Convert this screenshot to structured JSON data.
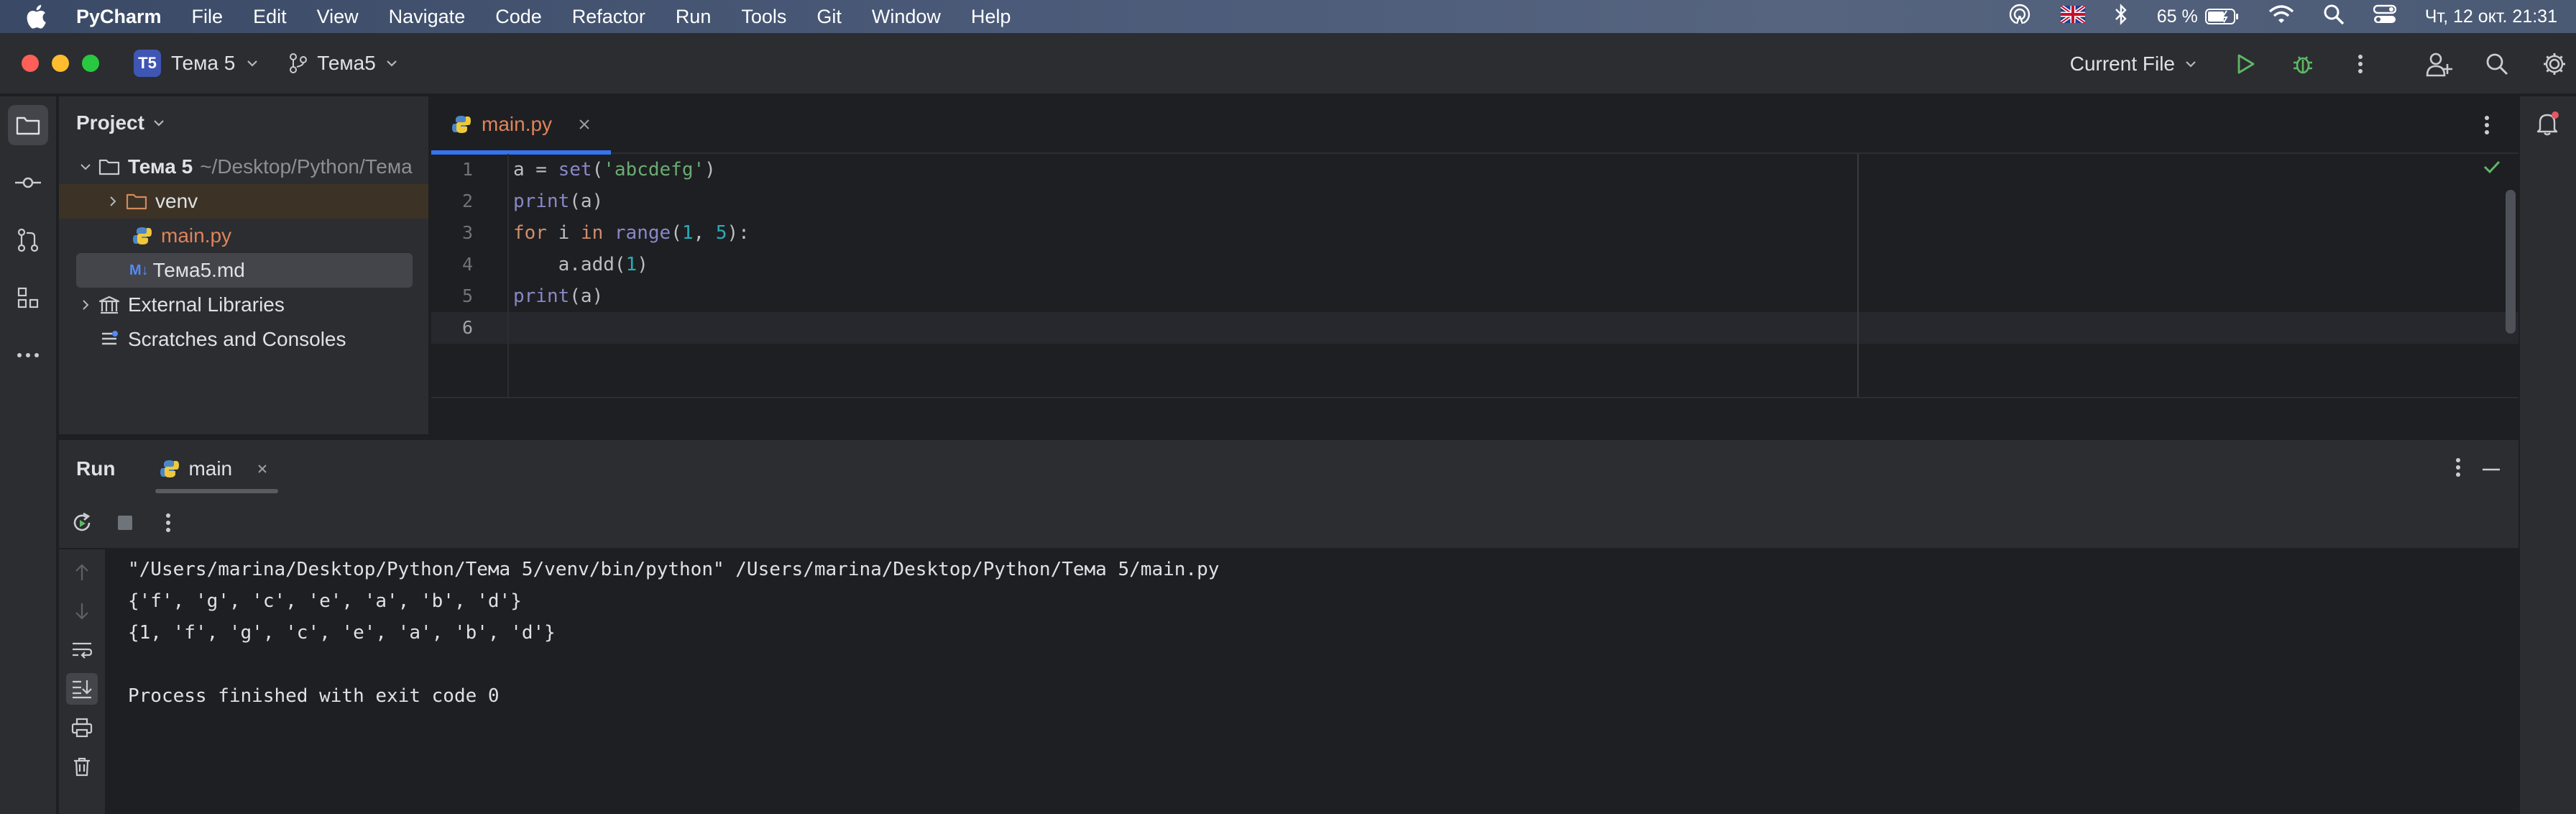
{
  "menubar": {
    "app_name": "PyCharm",
    "items": [
      "File",
      "Edit",
      "View",
      "Navigate",
      "Code",
      "Refactor",
      "Run",
      "Tools",
      "Git",
      "Window",
      "Help"
    ],
    "battery": "65 %",
    "datetime": "Чт, 12 окт.  21:31"
  },
  "toolbar": {
    "project_badge": "T5",
    "project_name": "Тема 5",
    "branch_name": "Тема5",
    "run_config": "Current File"
  },
  "project_panel": {
    "title": "Project",
    "root_name": "Тема 5",
    "root_path": "~/Desktop/Python/Тема",
    "items": [
      {
        "label": "venv"
      },
      {
        "label": "main.py"
      },
      {
        "label": "Тема5.md"
      },
      {
        "label": "External Libraries"
      },
      {
        "label": "Scratches and Consoles"
      }
    ],
    "md_badge": "M↓"
  },
  "editor": {
    "tab_label": "main.py",
    "line_numbers": [
      "1",
      "2",
      "3",
      "4",
      "5",
      "6"
    ],
    "lines": [
      [
        {
          "t": "a = ",
          "c": ""
        },
        {
          "t": "set",
          "c": "bi"
        },
        {
          "t": "(",
          "c": ""
        },
        {
          "t": "'abcdefg'",
          "c": "st"
        },
        {
          "t": ")",
          "c": ""
        }
      ],
      [
        {
          "t": "print",
          "c": "bi"
        },
        {
          "t": "(a)",
          "c": ""
        }
      ],
      [
        {
          "t": "for",
          "c": "kw"
        },
        {
          "t": " i ",
          "c": ""
        },
        {
          "t": "in",
          "c": "kw"
        },
        {
          "t": " ",
          "c": ""
        },
        {
          "t": "range",
          "c": "bi"
        },
        {
          "t": "(",
          "c": ""
        },
        {
          "t": "1",
          "c": "nu"
        },
        {
          "t": ", ",
          "c": ""
        },
        {
          "t": "5",
          "c": "nu"
        },
        {
          "t": "):",
          "c": ""
        }
      ],
      [
        {
          "t": "    a.add(",
          "c": ""
        },
        {
          "t": "1",
          "c": "nu"
        },
        {
          "t": ")",
          "c": ""
        }
      ],
      [
        {
          "t": "print",
          "c": "bi"
        },
        {
          "t": "(a)",
          "c": ""
        }
      ],
      [
        {
          "t": "",
          "c": ""
        }
      ]
    ]
  },
  "run_panel": {
    "title": "Run",
    "tab_label": "main",
    "console": [
      "\"/Users/marina/Desktop/Python/Тема 5/venv/bin/python\" /Users/marina/Desktop/Python/Тема 5/main.py",
      "{'f', 'g', 'c', 'e', 'a', 'b', 'd'}",
      "{1, 'f', 'g', 'c', 'e', 'a', 'b', 'd'}",
      "",
      "Process finished with exit code 0"
    ]
  },
  "colors": {
    "accent": "#3574f0",
    "open_file": "#e0835a",
    "keyword": "#cf8e6d",
    "builtin": "#8888c6",
    "string": "#6aab73",
    "number": "#2aacb8",
    "run_green": "#5fb865"
  }
}
